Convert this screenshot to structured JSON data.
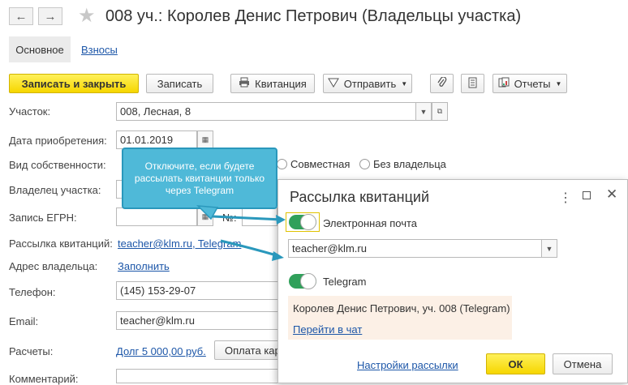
{
  "header": {
    "back_icon": "arrow-left-icon",
    "forward_icon": "arrow-right-icon",
    "title": "008 уч.: Королев Денис Петрович (Владельцы участка)"
  },
  "tabs": {
    "main": "Основное",
    "fees": "Взносы"
  },
  "toolbar": {
    "save_close": "Записать и закрыть",
    "save": "Записать",
    "receipt": "Квитанция",
    "send": "Отправить",
    "reports": "Отчеты"
  },
  "form": {
    "plot_label": "Участок:",
    "plot_value": "008, Лесная, 8",
    "acq_label": "Дата приобретения:",
    "acq_value": "01.01.2019",
    "ownership_label": "Вид собственности:",
    "ownership_options": [
      "Совместная",
      "Без владельца"
    ],
    "owner_label": "Владелец участка:",
    "egrn_label": "Запись ЕГРН:",
    "egrn_no_label": "№:",
    "mailing_label": "Рассылка квитанций:",
    "mailing_value": "teacher@klm.ru, Telegram",
    "address_label": "Адрес владельца:",
    "address_link": "Заполнить",
    "phone_label": "Телефон:",
    "phone_value": "(145) 153-29-07",
    "email_label": "Email:",
    "email_value": "teacher@klm.ru",
    "payments_label": "Расчеты:",
    "payments_link": "Долг 5 000,00 руб.",
    "pay_button": "Оплата кар",
    "comment_label": "Комментарий:"
  },
  "callout": {
    "text": "Отключите, если будете рассылать квитанции только через Telegram"
  },
  "dialog": {
    "title": "Рассылка квитанций",
    "email_toggle_label": "Электронная почта",
    "email_value": "teacher@klm.ru",
    "telegram_label": "Telegram",
    "contact_text": "Королев Денис Петрович, уч. 008 (Telegram)",
    "chat_link": "Перейти в чат",
    "settings_link": "Настройки рассылки",
    "ok": "ОК",
    "cancel": "Отмена"
  },
  "colors": {
    "primary": "#f6d600",
    "accent": "#30a05a",
    "callout": "#4fb9d8",
    "link": "#1c56a8"
  }
}
